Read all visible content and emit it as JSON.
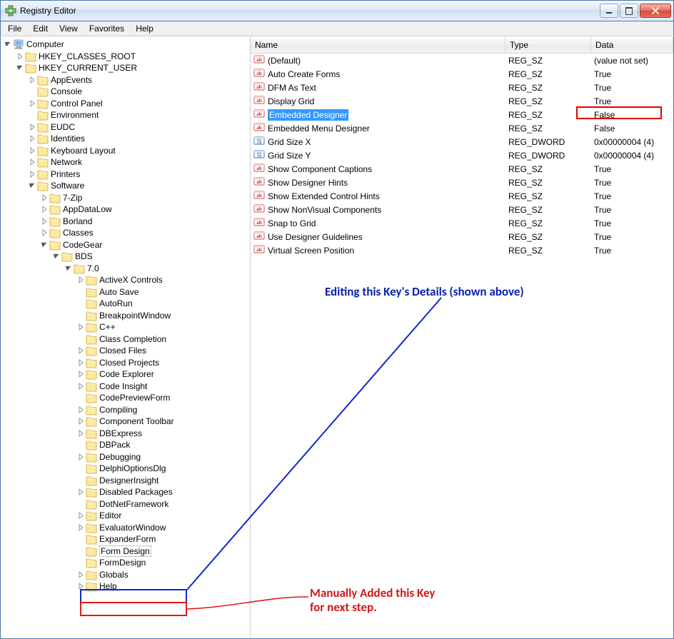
{
  "window": {
    "title": "Registry Editor"
  },
  "menu": [
    "File",
    "Edit",
    "View",
    "Favorites",
    "Help"
  ],
  "tree": {
    "root": "Computer",
    "hkcr": "HKEY_CLASSES_ROOT",
    "hkcu": "HKEY_CURRENT_USER",
    "hkcu_children": [
      "AppEvents",
      "Console",
      "Control Panel",
      "Environment",
      "EUDC",
      "Identities",
      "Keyboard Layout",
      "Network",
      "Printers",
      "Software"
    ],
    "software_children": [
      "7-Zip",
      "AppDataLow",
      "Borland",
      "Classes",
      "CodeGear"
    ],
    "codegear_child": "BDS",
    "bds_child": "7.0",
    "v70_children": [
      "ActiveX Controls",
      "Auto Save",
      "AutoRun",
      "BreakpointWindow",
      "C++",
      "Class Completion",
      "Closed Files",
      "Closed Projects",
      "Code Explorer",
      "Code Insight",
      "CodePreviewForm",
      "Compiling",
      "Component Toolbar",
      "DBExpress",
      "DBPack",
      "Debugging",
      "DelphiOptionsDlg",
      "DesignerInsight",
      "Disabled Packages",
      "DotNetFramework",
      "Editor",
      "EvaluatorWindow",
      "ExpanderForm",
      "Form Design",
      "FormDesign",
      "Globals",
      "Help"
    ]
  },
  "list": {
    "headers": {
      "name": "Name",
      "type": "Type",
      "data": "Data"
    }
  },
  "values": [
    {
      "icon": "str",
      "name": "(Default)",
      "type": "REG_SZ",
      "data": "(value not set)"
    },
    {
      "icon": "str",
      "name": "Auto Create Forms",
      "type": "REG_SZ",
      "data": "True"
    },
    {
      "icon": "str",
      "name": "DFM As Text",
      "type": "REG_SZ",
      "data": "True"
    },
    {
      "icon": "str",
      "name": "Display Grid",
      "type": "REG_SZ",
      "data": "True"
    },
    {
      "icon": "str",
      "name": "Embedded Designer",
      "type": "REG_SZ",
      "data": "False",
      "selected": true,
      "data_highlight": true
    },
    {
      "icon": "str",
      "name": "Embedded Menu Designer",
      "type": "REG_SZ",
      "data": "False"
    },
    {
      "icon": "dword",
      "name": "Grid Size X",
      "type": "REG_DWORD",
      "data": "0x00000004 (4)"
    },
    {
      "icon": "dword",
      "name": "Grid Size Y",
      "type": "REG_DWORD",
      "data": "0x00000004 (4)"
    },
    {
      "icon": "str",
      "name": "Show Component Captions",
      "type": "REG_SZ",
      "data": "True"
    },
    {
      "icon": "str",
      "name": "Show Designer Hints",
      "type": "REG_SZ",
      "data": "True"
    },
    {
      "icon": "str",
      "name": "Show Extended Control Hints",
      "type": "REG_SZ",
      "data": "True"
    },
    {
      "icon": "str",
      "name": "Show NonVisual Components",
      "type": "REG_SZ",
      "data": "True"
    },
    {
      "icon": "str",
      "name": "Snap to Grid",
      "type": "REG_SZ",
      "data": "True"
    },
    {
      "icon": "str",
      "name": "Use Designer Guidelines",
      "type": "REG_SZ",
      "data": "True"
    },
    {
      "icon": "str",
      "name": "Virtual Screen Position",
      "type": "REG_SZ",
      "data": "True"
    }
  ],
  "annotations": {
    "editing_text": "Editing this Key's Details (shown above)",
    "added_text_line1": "Manually Added this Key",
    "added_text_line2": "for next step."
  }
}
